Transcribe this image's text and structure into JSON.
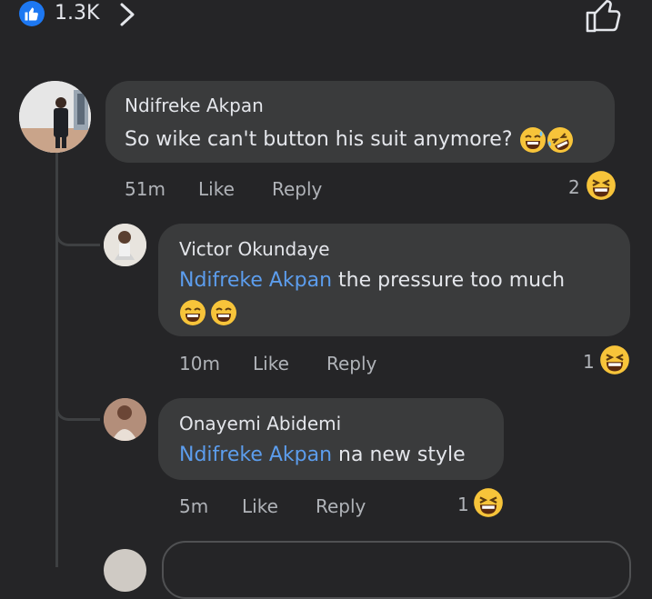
{
  "top": {
    "reaction_count": "1.3K"
  },
  "comments": [
    {
      "name": "Ndifreke Akpan",
      "text": "So wike can't button his suit anymore?",
      "time": "51m",
      "like": "Like",
      "reply": "Reply",
      "reactions": "2"
    },
    {
      "name": "Victor Okundaye",
      "mention": "Ndifreke Akpan",
      "text": " the pressure too much",
      "time": "10m",
      "like": "Like",
      "reply": "Reply",
      "reactions": "1"
    },
    {
      "name": "Onayemi Abidemi",
      "mention": "Ndifreke Akpan",
      "text": " na new style",
      "time": "5m",
      "like": "Like",
      "reply": "Reply",
      "reactions": "1"
    }
  ],
  "colors": {
    "background": "#252527",
    "bubble": "#3a3b3c",
    "mention": "#5c9ded",
    "like_blue": "#1d78f2",
    "emoji_yellow": "#f7c43a"
  }
}
